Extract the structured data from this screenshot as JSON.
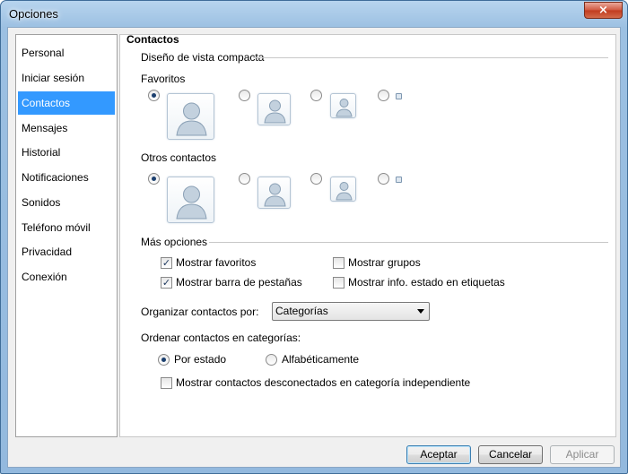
{
  "window": {
    "title": "Opciones",
    "close_glyph": "×"
  },
  "sidebar": {
    "items": [
      {
        "label": "Personal",
        "selected": false
      },
      {
        "label": "Iniciar sesión",
        "selected": false
      },
      {
        "label": "Contactos",
        "selected": true
      },
      {
        "label": "Mensajes",
        "selected": false
      },
      {
        "label": "Historial",
        "selected": false
      },
      {
        "label": "Notificaciones",
        "selected": false
      },
      {
        "label": "Sonidos",
        "selected": false
      },
      {
        "label": "Teléfono móvil",
        "selected": false
      },
      {
        "label": "Privacidad",
        "selected": false
      },
      {
        "label": "Conexión",
        "selected": false
      }
    ]
  },
  "main": {
    "title": "Contactos",
    "compact_group": "Diseño de vista compacta",
    "favorites_label": "Favoritos",
    "others_label": "Otros contactos",
    "more_options_group": "Más opciones",
    "checkboxes": {
      "show_favorites": {
        "label": "Mostrar favoritos",
        "checked": true
      },
      "show_groups": {
        "label": "Mostrar grupos",
        "checked": false
      },
      "show_tabs": {
        "label": "Mostrar barra de pestañas",
        "checked": true
      },
      "show_status": {
        "label": "Mostrar info. estado en etiquetas",
        "checked": false
      },
      "show_offline": {
        "label": "Mostrar contactos desconectados en categoría independiente",
        "checked": false
      }
    },
    "organize_label": "Organizar contactos por:",
    "organize_value": "Categorías",
    "sort_label": "Ordenar contactos en categorías:",
    "radios": {
      "by_status": {
        "label": "Por estado",
        "checked": true
      },
      "alphabetical": {
        "label": "Alfabéticamente",
        "checked": false
      }
    },
    "check_glyph": "✓"
  },
  "footer": {
    "ok": "Aceptar",
    "cancel": "Cancelar",
    "apply": "Aplicar"
  },
  "colors": {
    "selection": "#3399ff",
    "titlebar": "#9cc0e2",
    "close_button": "#c13b1e"
  }
}
